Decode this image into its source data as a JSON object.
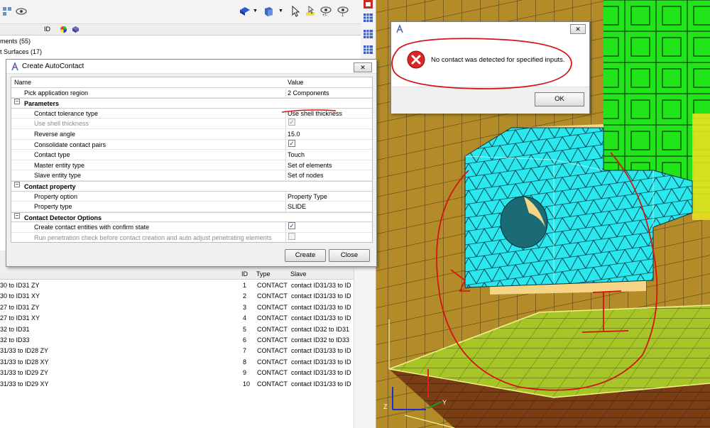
{
  "tree": {
    "header": {
      "id_col": "ID"
    },
    "rows": [
      {
        "label": "ments  (55)"
      },
      {
        "label": "t Surfaces  (17)"
      }
    ]
  },
  "dialog": {
    "title": "Create AutoContact",
    "close_glyph": "✕",
    "columns": {
      "name": "Name",
      "value": "Value"
    },
    "rows": [
      {
        "kind": "field",
        "name": "Pick application region",
        "value": "2 Components"
      },
      {
        "kind": "section",
        "name": "Parameters"
      },
      {
        "kind": "field",
        "name": "Contact tolerance type",
        "value": "Use shell thickness"
      },
      {
        "kind": "check",
        "name": "Use shell thickness",
        "checked": true,
        "disabled": true
      },
      {
        "kind": "field",
        "name": "Reverse angle",
        "value": "15.0"
      },
      {
        "kind": "check",
        "name": "Consolidate contact pairs",
        "checked": true,
        "disabled": false
      },
      {
        "kind": "field",
        "name": "Contact type",
        "value": "Touch"
      },
      {
        "kind": "field",
        "name": "Master entity type",
        "value": "Set of elements"
      },
      {
        "kind": "field",
        "name": "Slave entity type",
        "value": "Set of nodes"
      },
      {
        "kind": "section",
        "name": "Contact property"
      },
      {
        "kind": "field",
        "name": "Property option",
        "value": "Property Type"
      },
      {
        "kind": "field",
        "name": "Property type",
        "value": "SLIDE"
      },
      {
        "kind": "section",
        "name": "Contact Detector Options"
      },
      {
        "kind": "check",
        "name": "Create contact entities with confirm state",
        "checked": true,
        "disabled": false
      },
      {
        "kind": "check",
        "name": "Run penetration check before contact creation and auto adjust penetrating elements",
        "checked": false,
        "disabled": true
      }
    ],
    "create_label": "Create",
    "close_label": "Close"
  },
  "contacts": {
    "columns": {
      "id": "ID",
      "type": "Type",
      "slave": "Slave"
    },
    "rows": [
      {
        "name": "30 to ID31 ZY",
        "id": "1",
        "type": "CONTACT",
        "slave": "contact ID31/33 to ID"
      },
      {
        "name": "30 to ID31 XY",
        "id": "2",
        "type": "CONTACT",
        "slave": "contact ID31/33 to ID"
      },
      {
        "name": "27 to ID31 ZY",
        "id": "3",
        "type": "CONTACT",
        "slave": "contact ID31/33 to ID"
      },
      {
        "name": "27 to ID31 XY",
        "id": "4",
        "type": "CONTACT",
        "slave": "contact ID31/33 to ID"
      },
      {
        "name": "32 to ID31",
        "id": "5",
        "type": "CONTACT",
        "slave": "contact ID32 to ID31"
      },
      {
        "name": "32 to ID33",
        "id": "6",
        "type": "CONTACT",
        "slave": "contact ID32 to ID33"
      },
      {
        "name": "31/33 to ID28 ZY",
        "id": "7",
        "type": "CONTACT",
        "slave": "contact ID31/33 to ID"
      },
      {
        "name": "31/33 to ID28 XY",
        "id": "8",
        "type": "CONTACT",
        "slave": "contact ID31/33 to ID"
      },
      {
        "name": "31/33 to ID29 ZY",
        "id": "9",
        "type": "CONTACT",
        "slave": "contact ID31/33 to ID"
      },
      {
        "name": "31/33 to ID29 XY",
        "id": "10",
        "type": "CONTACT",
        "slave": "contact ID31/33 to ID"
      }
    ]
  },
  "message_box": {
    "close_glyph": "✕",
    "text": "No contact was detected for specified inputs.",
    "ok_label": "OK",
    "error_glyph": "✕"
  },
  "viewport": {
    "axis_z": "Z",
    "axis_y": "Y"
  },
  "colors": {
    "annotation_red": "#d41414",
    "mesh_cyan": "#27e8ec",
    "floor_green": "#a2c41e",
    "block_green": "#22e61a",
    "background_brown": "#b08a27"
  }
}
